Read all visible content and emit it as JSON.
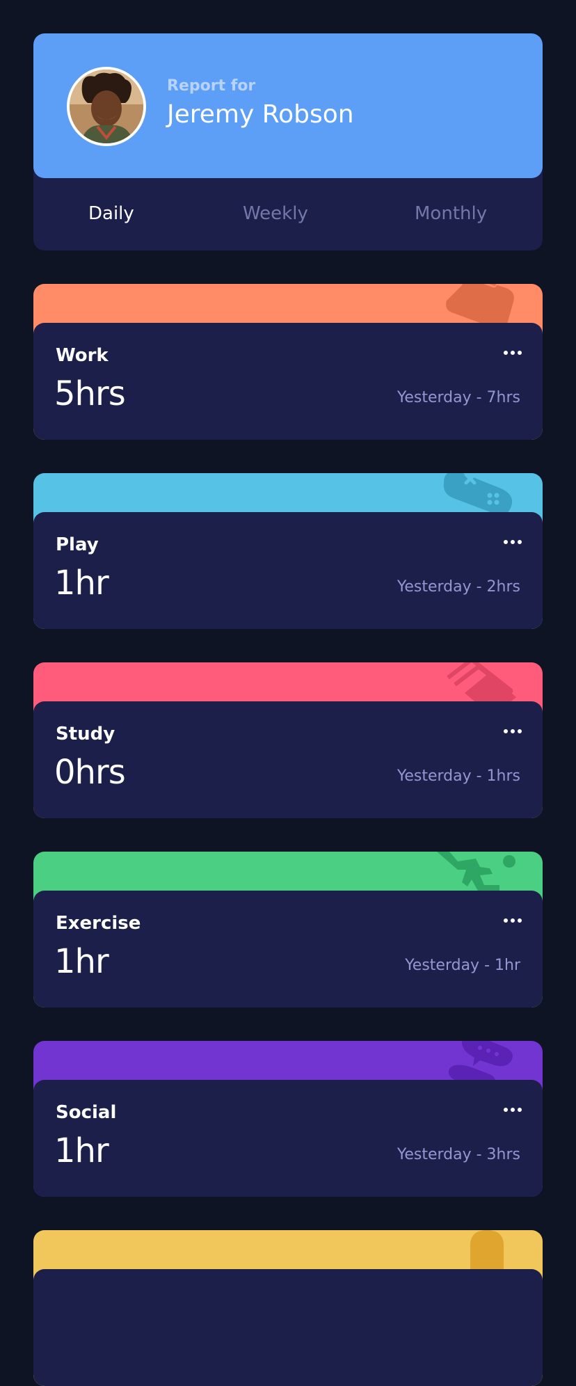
{
  "profile": {
    "report_label": "Report for",
    "name": "Jeremy Robson",
    "avatar_icon": "user-avatar",
    "tabs": [
      {
        "label": "Daily",
        "active": true
      },
      {
        "label": "Weekly",
        "active": false
      },
      {
        "label": "Monthly",
        "active": false
      }
    ]
  },
  "activities": [
    {
      "title": "Work",
      "current": "5hrs",
      "previous": "Yesterday - 7hrs",
      "color": "#ff8c66",
      "icon": "briefcase-icon"
    },
    {
      "title": "Play",
      "current": "1hr",
      "previous": "Yesterday - 2hrs",
      "color": "#56c2e6",
      "icon": "gamepad-icon"
    },
    {
      "title": "Study",
      "current": "0hrs",
      "previous": "Yesterday - 1hrs",
      "color": "#ff5c7c",
      "icon": "books-icon"
    },
    {
      "title": "Exercise",
      "current": "1hr",
      "previous": "Yesterday - 1hr",
      "color": "#4bcf82",
      "icon": "running-icon"
    },
    {
      "title": "Social",
      "current": "1hr",
      "previous": "Yesterday - 3hrs",
      "color": "#7335d2",
      "icon": "speech-bubbles-icon"
    },
    {
      "title": "",
      "current": "",
      "previous": "",
      "color": "#f1c75b",
      "icon": "self-care-icon"
    }
  ],
  "colors": {
    "page_bg": "#0f1424",
    "card_bg": "#1c1f4a",
    "profile_bg": "#5d9ff7",
    "muted_text": "#7278a8"
  }
}
